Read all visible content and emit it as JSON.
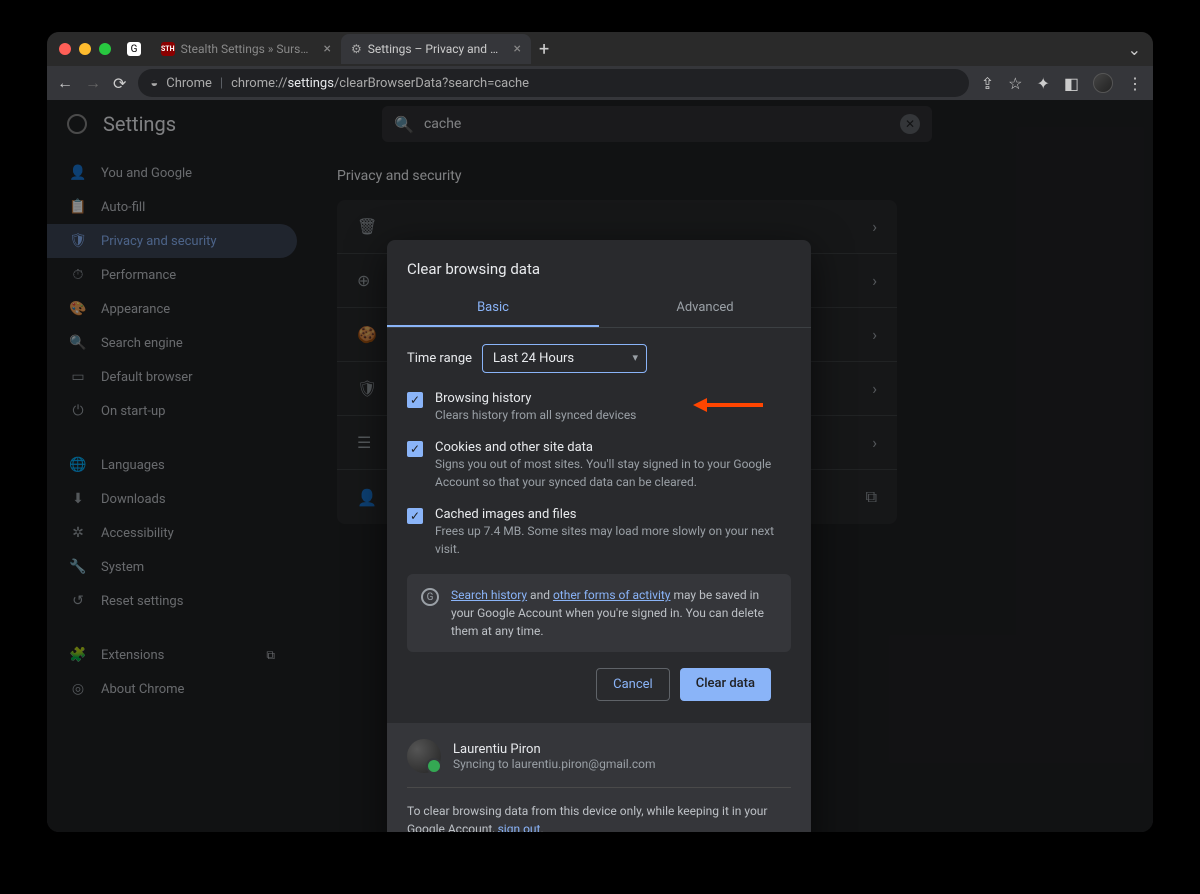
{
  "window": {
    "tabs": [
      {
        "title": "Stealth Settings » Sursa de tut",
        "favicon_label": "STH"
      },
      {
        "title": "Settings – Privacy and security"
      }
    ],
    "url_prefix": "Chrome",
    "url_segments": {
      "scheme": "chrome://",
      "host": "settings",
      "path": "/clearBrowserData?search=cache"
    }
  },
  "settings": {
    "title": "Settings",
    "search_value": "cache",
    "sidebar": [
      {
        "icon": "person",
        "label": "You and Google"
      },
      {
        "icon": "clipboard",
        "label": "Auto-fill"
      },
      {
        "icon": "shield",
        "label": "Privacy and security",
        "active": true
      },
      {
        "icon": "speed",
        "label": "Performance"
      },
      {
        "icon": "palette",
        "label": "Appearance"
      },
      {
        "icon": "search",
        "label": "Search engine"
      },
      {
        "icon": "window",
        "label": "Default browser"
      },
      {
        "icon": "power",
        "label": "On start-up"
      }
    ],
    "sidebar2": [
      {
        "icon": "globe",
        "label": "Languages"
      },
      {
        "icon": "download",
        "label": "Downloads"
      },
      {
        "icon": "accessibility",
        "label": "Accessibility"
      },
      {
        "icon": "wrench",
        "label": "System"
      },
      {
        "icon": "reset",
        "label": "Reset settings"
      }
    ],
    "sidebar3": [
      {
        "icon": "puzzle",
        "label": "Extensions",
        "external": true
      },
      {
        "icon": "chrome",
        "label": "About Chrome"
      }
    ],
    "section_title": "Privacy and security"
  },
  "dialog": {
    "title": "Clear browsing data",
    "tabs": {
      "basic": "Basic",
      "advanced": "Advanced"
    },
    "time_range_label": "Time range",
    "time_range_value": "Last 24 Hours",
    "items": [
      {
        "title": "Browsing history",
        "sub": "Clears history from all synced devices"
      },
      {
        "title": "Cookies and other site data",
        "sub": "Signs you out of most sites. You'll stay signed in to your Google Account so that your synced data can be cleared."
      },
      {
        "title": "Cached images and files",
        "sub": "Frees up 7.4 MB. Some sites may load more slowly on your next visit."
      }
    ],
    "info": {
      "link1": "Search history",
      "mid1": " and ",
      "link2": "other forms of activity",
      "rest": " may be saved in your Google Account when you're signed in. You can delete them at any time."
    },
    "buttons": {
      "cancel": "Cancel",
      "clear": "Clear data"
    },
    "user": {
      "name": "Laurentiu Piron",
      "sync": "Syncing to laurentiu.piron@gmail.com"
    },
    "signout": {
      "pre": "To clear browsing data from this device only, while keeping it in your Google Account, ",
      "link": "sign out",
      "post": "."
    }
  }
}
